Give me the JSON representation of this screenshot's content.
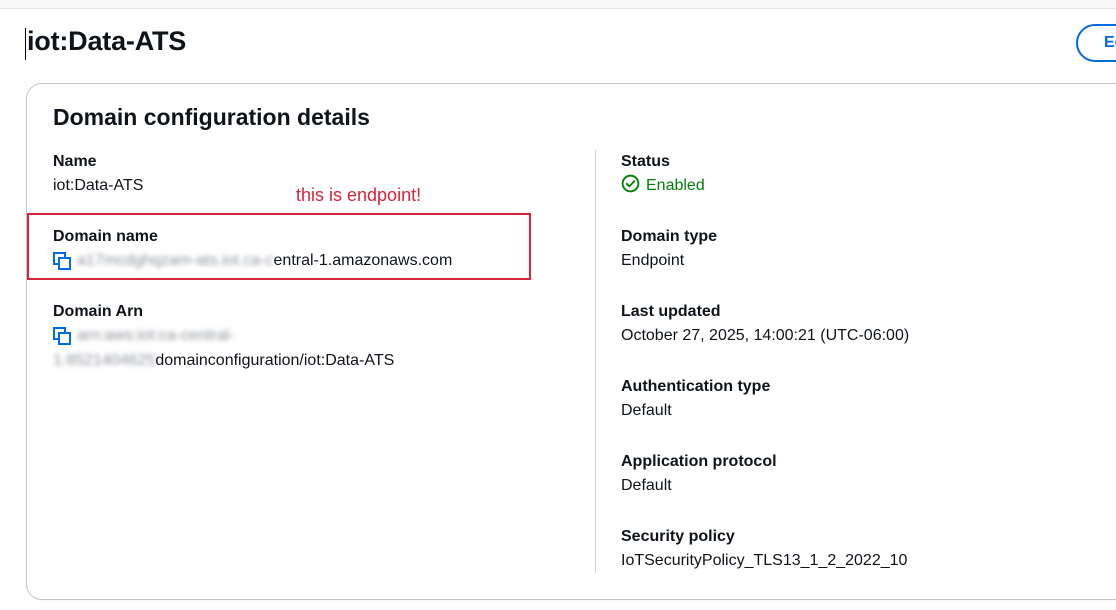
{
  "header": {
    "title": "iot:Data-ATS",
    "edit_label": "Edit"
  },
  "card": {
    "title": "Domain configuration details"
  },
  "left": {
    "name_label": "Name",
    "name_value": "iot:Data-ATS",
    "domain_name_label": "Domain name",
    "domain_name_blurred": "a17mcdghqzam-ats.iot.ca-c",
    "domain_name_visible": "entral-1.amazonaws.com",
    "domain_arn_label": "Domain Arn",
    "domain_arn_line1_blurred": "arn:aws:iot:ca-central-",
    "domain_arn_line2_blurred": "1:8521404625",
    "domain_arn_line2_visible": "domainconfiguration/iot:Data-ATS"
  },
  "right": {
    "status_label": "Status",
    "status_value": "Enabled",
    "domain_type_label": "Domain type",
    "domain_type_value": "Endpoint",
    "last_updated_label": "Last updated",
    "last_updated_value": "October 27, 2025, 14:00:21 (UTC-06:00)",
    "auth_type_label": "Authentication type",
    "auth_type_value": "Default",
    "app_protocol_label": "Application protocol",
    "app_protocol_value": "Default",
    "security_policy_label": "Security policy",
    "security_policy_value": "IoTSecurityPolicy_TLS13_1_2_2022_10"
  },
  "annotation": {
    "text": "this is endpoint!"
  },
  "icons": {
    "copy": "copy-icon",
    "status": "check-circle-icon"
  },
  "colors": {
    "accent": "#006ce0",
    "success": "#037f0c",
    "annotation": "#d6243a"
  }
}
